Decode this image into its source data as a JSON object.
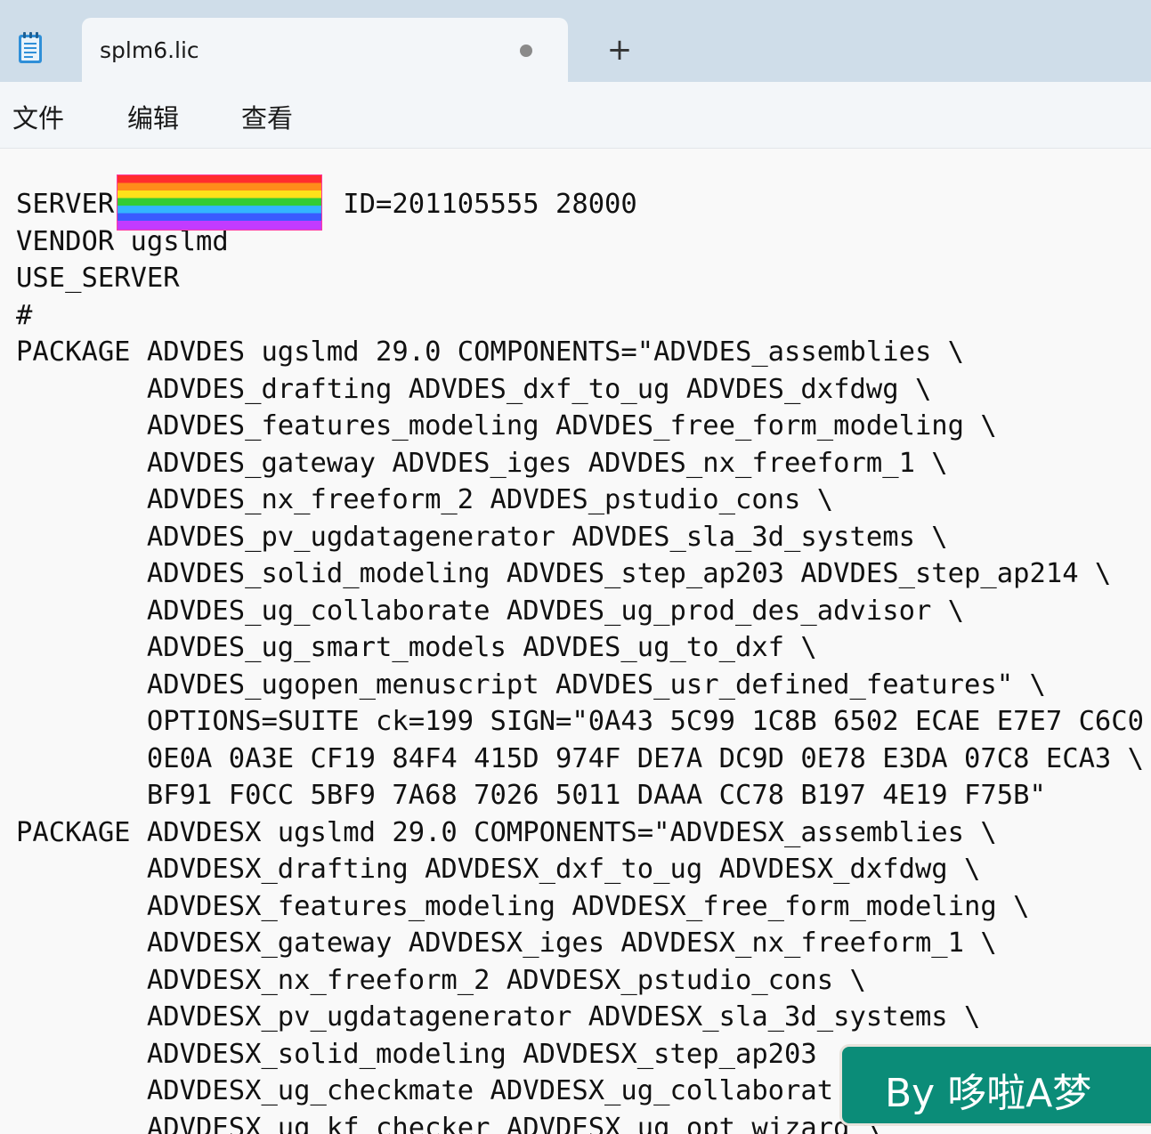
{
  "window": {
    "tab_title": "splm6.lic",
    "new_tab_label": "+"
  },
  "menu": {
    "items": [
      "文件",
      "编辑",
      "查看"
    ]
  },
  "editor": {
    "lines": [
      "SERVER              ID=201105555 28000",
      "VENDOR ugslmd",
      "USE_SERVER",
      "#",
      "PACKAGE ADVDES ugslmd 29.0 COMPONENTS=\"ADVDES_assemblies \\",
      "        ADVDES_drafting ADVDES_dxf_to_ug ADVDES_dxfdwg \\",
      "        ADVDES_features_modeling ADVDES_free_form_modeling \\",
      "        ADVDES_gateway ADVDES_iges ADVDES_nx_freeform_1 \\",
      "        ADVDES_nx_freeform_2 ADVDES_pstudio_cons \\",
      "        ADVDES_pv_ugdatagenerator ADVDES_sla_3d_systems \\",
      "        ADVDES_solid_modeling ADVDES_step_ap203 ADVDES_step_ap214 \\",
      "        ADVDES_ug_collaborate ADVDES_ug_prod_des_advisor \\",
      "        ADVDES_ug_smart_models ADVDES_ug_to_dxf \\",
      "        ADVDES_ugopen_menuscript ADVDES_usr_defined_features\" \\",
      "        OPTIONS=SUITE ck=199 SIGN=\"0A43 5C99 1C8B 6502 ECAE E7E7 C6C0",
      "        0E0A 0A3E CF19 84F4 415D 974F DE7A DC9D 0E78 E3DA 07C8 ECA3 \\",
      "        BF91 F0CC 5BF9 7A68 7026 5011 DAAA CC78 B197 4E19 F75B\"",
      "PACKAGE ADVDESX ugslmd 29.0 COMPONENTS=\"ADVDESX_assemblies \\",
      "        ADVDESX_drafting ADVDESX_dxf_to_ug ADVDESX_dxfdwg \\",
      "        ADVDESX_features_modeling ADVDESX_free_form_modeling \\",
      "        ADVDESX_gateway ADVDESX_iges ADVDESX_nx_freeform_1 \\",
      "        ADVDESX_nx_freeform_2 ADVDESX_pstudio_cons \\",
      "        ADVDESX_pv_ugdatagenerator ADVDESX_sla_3d_systems \\",
      "        ADVDESX_solid_modeling ADVDESX_step_ap203",
      "        ADVDESX_ug_checkmate ADVDESX_ug_collaborat",
      "        ADVDESX_ug_kf_checker ADVDESX_ug_opt_wizard \\"
    ]
  },
  "watermark": {
    "text": "By 哆啦A梦"
  },
  "colors": {
    "tabbar_bg": "#cfdde9",
    "menubar_bg": "#f3f6f9",
    "editor_bg": "#f9f9f9",
    "watermark_bg": "#0b8c78",
    "icon_accent": "#2f8fd8"
  },
  "icons": {
    "app": "notepad-icon",
    "unsaved": "unsaved-dot-icon",
    "new_tab": "plus-icon"
  }
}
